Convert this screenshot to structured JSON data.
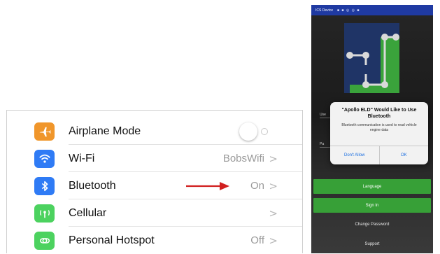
{
  "settings": {
    "rows": [
      {
        "label": "Airplane Mode",
        "value": "",
        "icon": "airplane-icon",
        "color": "#f0962b",
        "control": "toggle"
      },
      {
        "label": "Wi-Fi",
        "value": "BobsWifi",
        "icon": "wifi-icon",
        "color": "#2f7bf5",
        "control": "chevron"
      },
      {
        "label": "Bluetooth",
        "value": "On",
        "icon": "bluetooth-icon",
        "color": "#2f7bf5",
        "control": "chevron"
      },
      {
        "label": "Cellular",
        "value": "",
        "icon": "cellular-icon",
        "color": "#4cd25f",
        "control": "chevron"
      },
      {
        "label": "Personal Hotspot",
        "value": "Off",
        "icon": "hotspot-icon",
        "color": "#4cd25f",
        "control": "chevron"
      }
    ],
    "chevron": ">",
    "arrow_color": "#d11f1f"
  },
  "phone": {
    "status": {
      "carrier": "ICS Device",
      "icons": "■ ■ ◎ ◎ ■"
    },
    "logo_colors": {
      "blue": "#1f3466",
      "green": "#3aa33b",
      "node": "#cfcfcf"
    },
    "background_fields": {
      "first_initial": "Use",
      "second_initial": "Pa"
    },
    "dialog": {
      "title": "\"Apollo ELD\" Would Like to Use Bluetooth",
      "message": "Bluetooth communication is used to read vehicle engine data",
      "deny_label": "Don't Allow",
      "ok_label": "OK"
    },
    "buttons": {
      "language": "Language",
      "signin": "Sign In"
    },
    "links": {
      "change_password": "Change Password",
      "support": "Support"
    }
  }
}
